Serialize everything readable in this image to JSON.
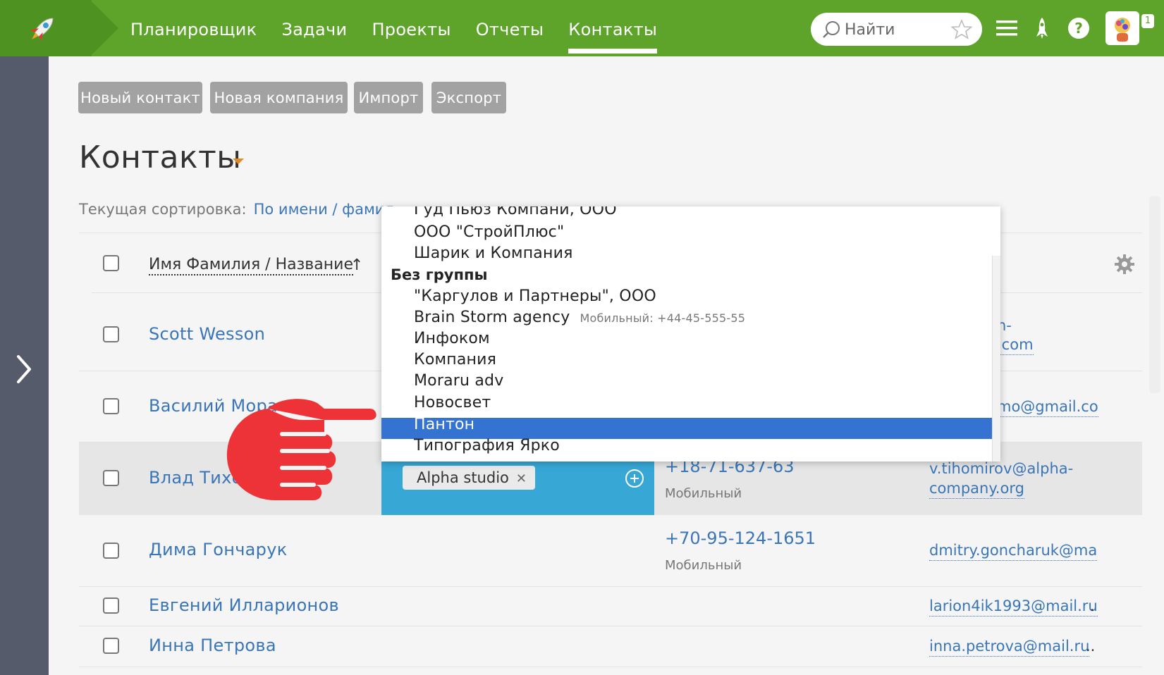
{
  "topbar": {
    "nav": [
      "Планировщик",
      "Задачи",
      "Проекты",
      "Отчеты",
      "Контакты"
    ],
    "active_nav": "Контакты",
    "search_placeholder": "Найти",
    "notifications_count": "1",
    "icons": [
      "rocket-icon",
      "search-icon",
      "star-icon",
      "menu-icon",
      "launch-icon",
      "help-icon",
      "avatar"
    ]
  },
  "toolbar": {
    "new_contact": "Новый контакт",
    "new_company": "Новая компания",
    "import": "Импорт",
    "export": "Экспорт"
  },
  "page": {
    "title": "Контакты",
    "sort_label": "Текущая сортировка:",
    "sort_value": "По имени / фамил",
    "column_name": "Имя Фамилия / Название",
    "sort_arrow": "↑"
  },
  "rows": [
    {
      "name": "Scott Wesson",
      "email_line1": "n-",
      "email_line2": ".com"
    },
    {
      "name": "Василий Мора",
      "email": "mo@gmail.co"
    },
    {
      "name": "Влад Тихо",
      "phone": "+18-71-637-63",
      "phone_type": "Мобильный",
      "email_line1": "v.tihomirov@alpha-",
      "email_line2": "company.org",
      "tag": "Alpha studio"
    },
    {
      "name": "Дима Гончарук",
      "phone": "+70-95-124-1651",
      "phone_type": "Мобильный",
      "email": "dmitry.goncharuk@ma"
    },
    {
      "name": "Евгений Илларионов",
      "email": "larion4ik1993@mail.ru",
      "email_suffix": "."
    },
    {
      "name": "Инна Петрова",
      "email": "inna.petrova@mail.ru",
      "email_suffix": ".."
    }
  ],
  "dropdown": {
    "items_top": [
      "Гуд Пьюз Компани, ООО",
      "ООО \"СтройПлюс\"",
      "Шарик и Компания"
    ],
    "group": "Без группы",
    "items": [
      "\"Каргулов и Партнеры\", ООО",
      "Brain Storm agency",
      "Инфоком",
      "Компания",
      "Moraru adv",
      "Новосвет",
      "Пантон",
      "Типография Ярко"
    ],
    "brainstorm_sub": "Мобильный: +44-45-555-55",
    "selected": "Пантон"
  },
  "colors": {
    "topbar": "#5ea42a",
    "link": "#3a76b7",
    "tag_cell": "#37a7d6",
    "selection": "#3573d3",
    "rail": "#565b6b"
  }
}
